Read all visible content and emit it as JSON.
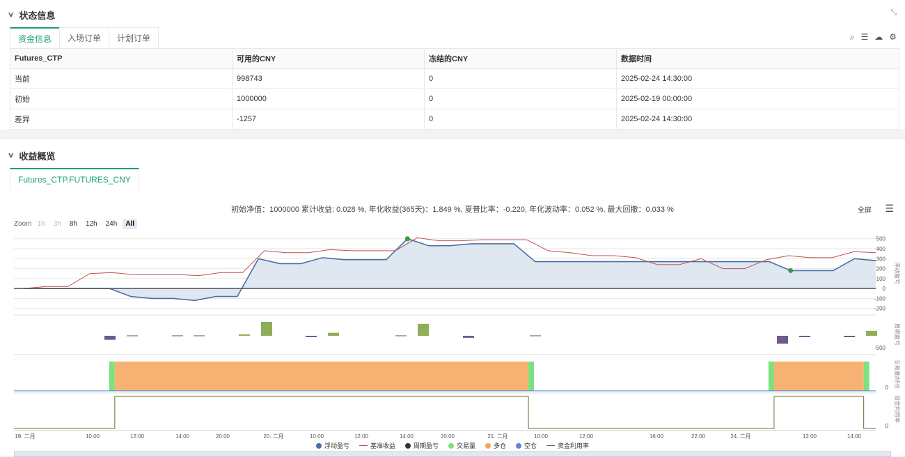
{
  "status": {
    "title": "状态信息",
    "tabs": [
      "资金信息",
      "入场订单",
      "计划订单"
    ],
    "table": {
      "headers": [
        "Futures_CTP",
        "可用的CNY",
        "冻结的CNY",
        "数据时间"
      ],
      "rows": [
        [
          "当前",
          "998743",
          "0",
          "2025-02-24 14:30:00"
        ],
        [
          "初始",
          "1000000",
          "0",
          "2025-02-19 00:00:00"
        ],
        [
          "差异",
          "-1257",
          "0",
          "2025-02-24 14:30:00"
        ]
      ]
    }
  },
  "profit": {
    "title": "收益概览",
    "tab": "Futures_CTP.FUTURES_CNY",
    "summary": "初始净值：1000000 累计收益: 0.028 %, 年化收益(365天)：1.849 %, 夏普比率：-0.220, 年化波动率：0.052 %, 最大回撤：0.033 %",
    "fullscreen": "全屏",
    "zoom": {
      "label": "Zoom",
      "buttons": [
        "1h",
        "3h",
        "8h",
        "12h",
        "24h",
        "All"
      ]
    }
  },
  "chart_data": {
    "type": "line",
    "x_ticks": [
      "19. 二月",
      "10:00",
      "12:00",
      "14:00",
      "20:00",
      "20. 二月",
      "10:00",
      "12:00",
      "14:00",
      "20:00",
      "21. 二月",
      "10:00",
      "12:00",
      "16:00",
      "22:00",
      "24. 二月",
      "12:00",
      "14:00"
    ],
    "panes": [
      {
        "name": "浮动盈亏",
        "y_ticks": [
          "500",
          "400",
          "300",
          "200",
          "100",
          "0",
          "-100",
          "-200"
        ],
        "ylim": [
          -230,
          540
        ]
      },
      {
        "name": "周期盈亏",
        "y_ticks": [
          "-500"
        ]
      },
      {
        "name": "交易量/持仓",
        "y_ticks": [
          "0"
        ]
      },
      {
        "name": "资金利用率",
        "y_ticks": [
          "0"
        ]
      }
    ],
    "series": [
      {
        "name": "浮动盈亏",
        "color": "#4a6fa5",
        "values": [
          0,
          0,
          0,
          0,
          0,
          -80,
          -100,
          -100,
          -120,
          -80,
          -80,
          300,
          250,
          250,
          310,
          290,
          290,
          290,
          500,
          430,
          430,
          450,
          450,
          450,
          270,
          270,
          270,
          270,
          270,
          270,
          270,
          270,
          270,
          270,
          270,
          270,
          180,
          180,
          180,
          300,
          280
        ]
      },
      {
        "name": "基准收益",
        "color": "#c0504d",
        "values": [
          0,
          20,
          20,
          150,
          160,
          140,
          140,
          140,
          130,
          160,
          160,
          380,
          360,
          360,
          390,
          380,
          380,
          380,
          510,
          480,
          480,
          490,
          490,
          490,
          380,
          360,
          330,
          330,
          310,
          240,
          240,
          300,
          200,
          200,
          290,
          330,
          310,
          310,
          370,
          360
        ]
      },
      {
        "name": "周期盈亏",
        "color": "#333333"
      },
      {
        "name": "交易量",
        "color": "#7ee07e"
      },
      {
        "name": "多仓",
        "color": "#f6a55a"
      },
      {
        "name": "空仓",
        "color": "#6b7fd6"
      },
      {
        "name": "资金利用率",
        "color": "#6b6b3a"
      }
    ],
    "period_bars": [
      -40,
      0,
      0,
      0,
      10,
      140,
      -10,
      30,
      0,
      120,
      -20,
      0,
      -80,
      -10,
      -10,
      50
    ],
    "long_positions": [
      [
        0.117,
        0.597
      ],
      [
        0.882,
        0.986
      ]
    ],
    "utilization": [
      [
        0.117,
        0.597
      ],
      [
        0.882,
        0.986
      ]
    ]
  }
}
